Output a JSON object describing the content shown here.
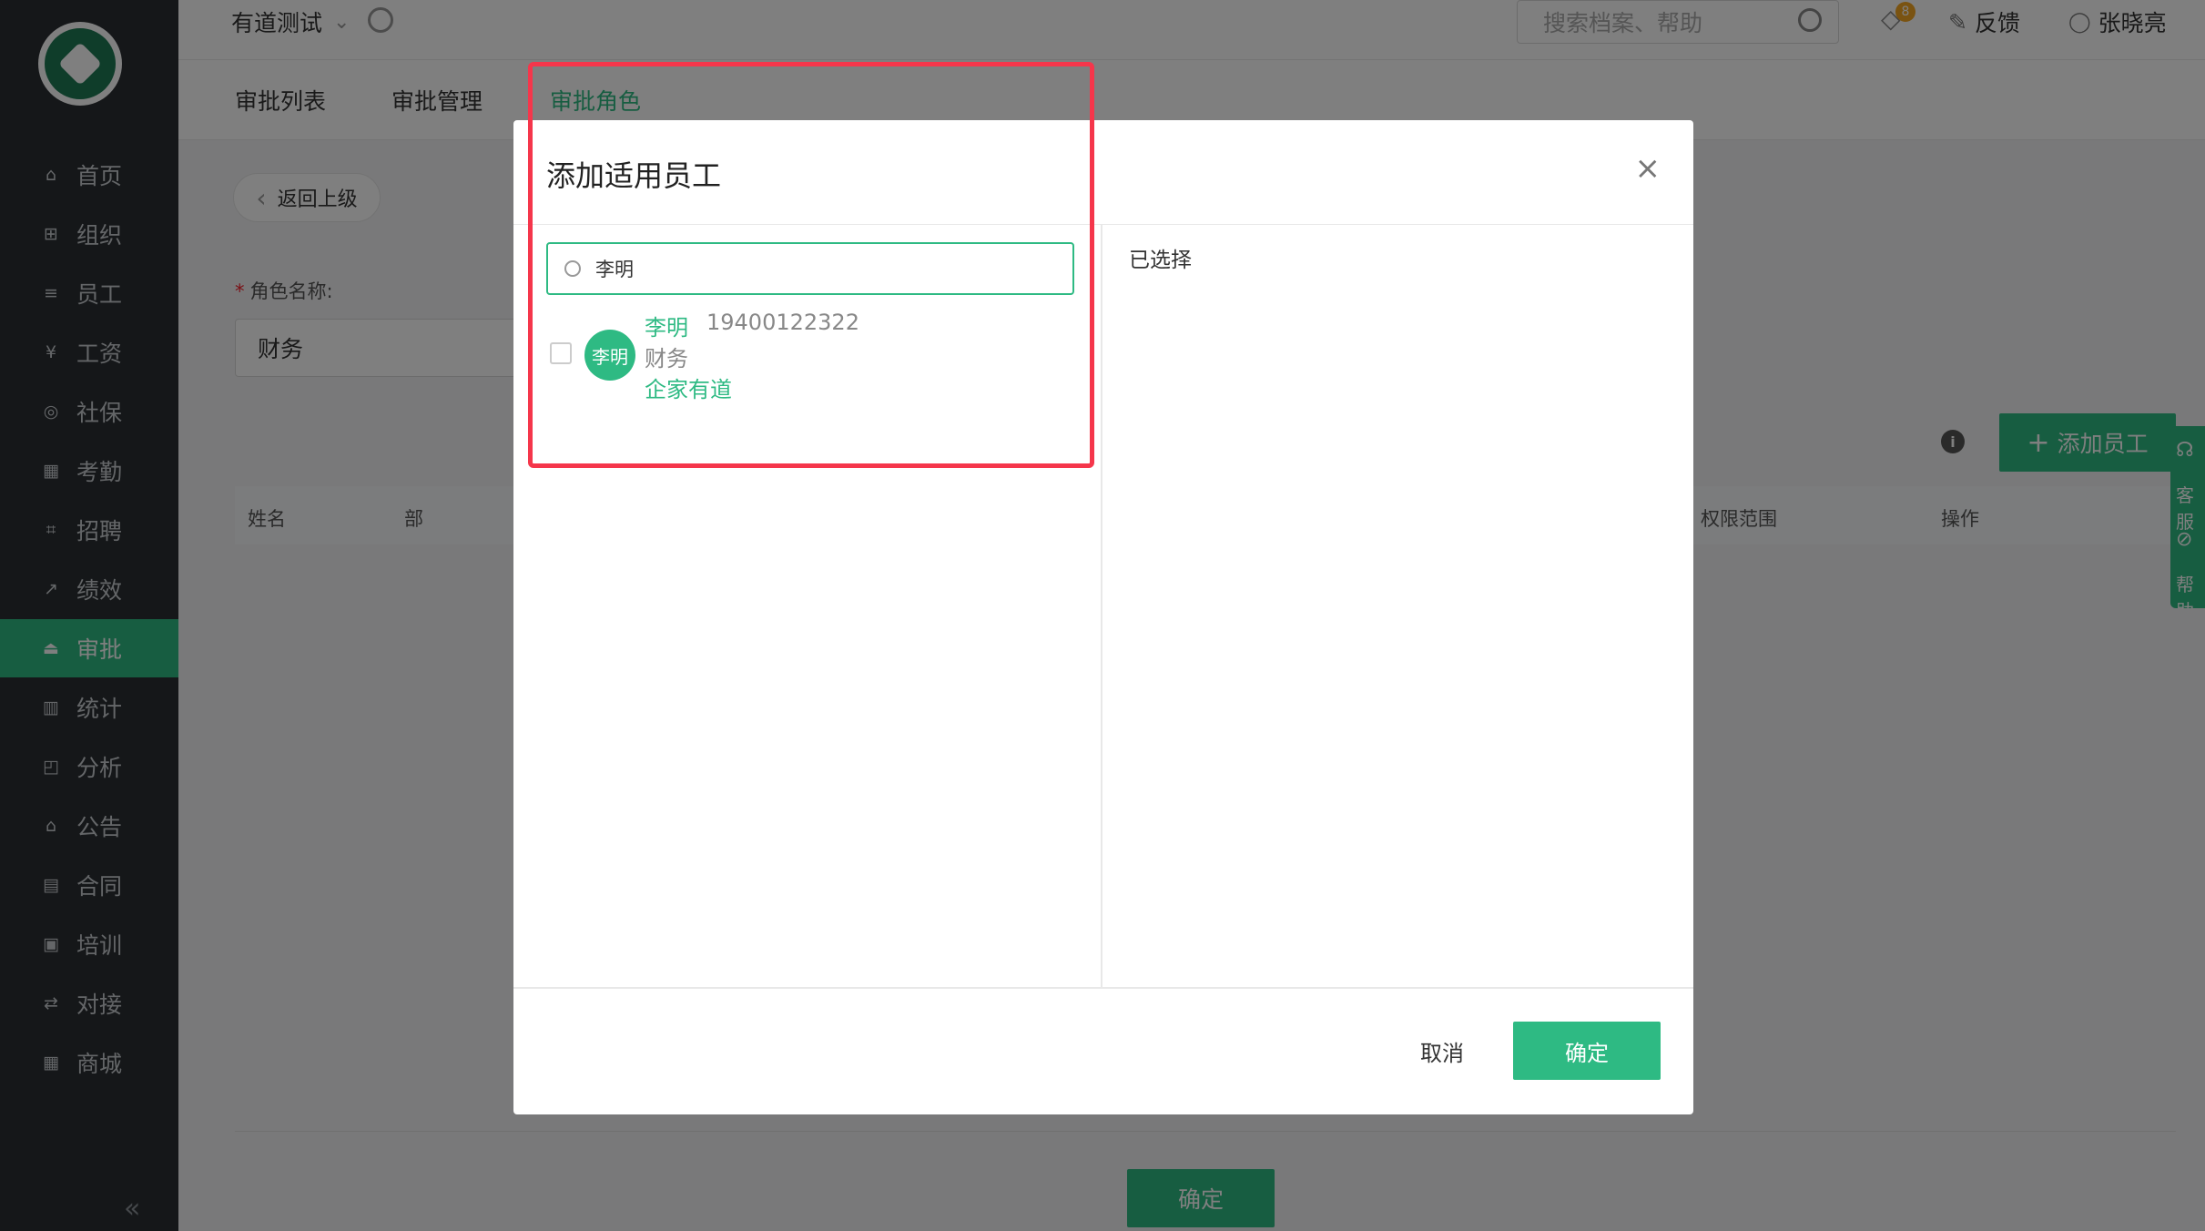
{
  "sidebar": {
    "items": [
      {
        "label": "首页",
        "icon": "home-icon",
        "glyph": "⌂"
      },
      {
        "label": "组织",
        "icon": "org-icon",
        "glyph": "⊞"
      },
      {
        "label": "员工",
        "icon": "employee-icon",
        "glyph": "≡"
      },
      {
        "label": "工资",
        "icon": "salary-icon",
        "glyph": "¥"
      },
      {
        "label": "社保",
        "icon": "social-security-icon",
        "glyph": "◎"
      },
      {
        "label": "考勤",
        "icon": "attendance-icon",
        "glyph": "▦"
      },
      {
        "label": "招聘",
        "icon": "recruit-icon",
        "glyph": "⌗"
      },
      {
        "label": "绩效",
        "icon": "performance-icon",
        "glyph": "↗"
      },
      {
        "label": "审批",
        "icon": "approval-icon",
        "glyph": "⏏"
      },
      {
        "label": "统计",
        "icon": "statistics-icon",
        "glyph": "▥"
      },
      {
        "label": "分析",
        "icon": "analysis-icon",
        "glyph": "◰"
      },
      {
        "label": "公告",
        "icon": "notice-icon",
        "glyph": "⌂"
      },
      {
        "label": "合同",
        "icon": "contract-icon",
        "glyph": "▤"
      },
      {
        "label": "培训",
        "icon": "training-icon",
        "glyph": "▣"
      },
      {
        "label": "对接",
        "icon": "integration-icon",
        "glyph": "⇄"
      },
      {
        "label": "商城",
        "icon": "store-icon",
        "glyph": "▦"
      }
    ],
    "active": "审批",
    "collapse_glyph": "«"
  },
  "header": {
    "company": "有道测试",
    "company_chevron": "⌄",
    "search_placeholder": "搜索档案、帮助",
    "badge_count": "8",
    "feedback": "反馈",
    "feedback_glyph": "✎",
    "user": "张晓亮",
    "user_glyph": "◯"
  },
  "tabs": [
    {
      "label": "审批列表"
    },
    {
      "label": "审批管理"
    },
    {
      "label": "审批角色"
    }
  ],
  "page": {
    "back_label": "返回上级",
    "back_glyph": "‹",
    "role_label": "角色名称:",
    "required_mark": "*",
    "role_value": "财务",
    "info_glyph": "i",
    "add_employee": "添加员工",
    "add_glyph": "+",
    "columns": [
      "姓名",
      "部",
      "权限范围",
      "操作"
    ],
    "confirm": "确定"
  },
  "float_service": {
    "service": "客服",
    "help": "帮助"
  },
  "modal": {
    "title": "添加适用员工",
    "close_glyph": "×",
    "search_value": "李明",
    "selected_label": "已选择",
    "employee": {
      "avatar": "李明",
      "name": "李明",
      "phone": "19400122322",
      "dept": "财务",
      "company": "企家有道"
    },
    "cancel": "取消",
    "ok": "确定"
  },
  "colors": {
    "accent": "#2eba83",
    "sidebar_bg": "#2a2f33",
    "highlight": "#f5364b"
  }
}
